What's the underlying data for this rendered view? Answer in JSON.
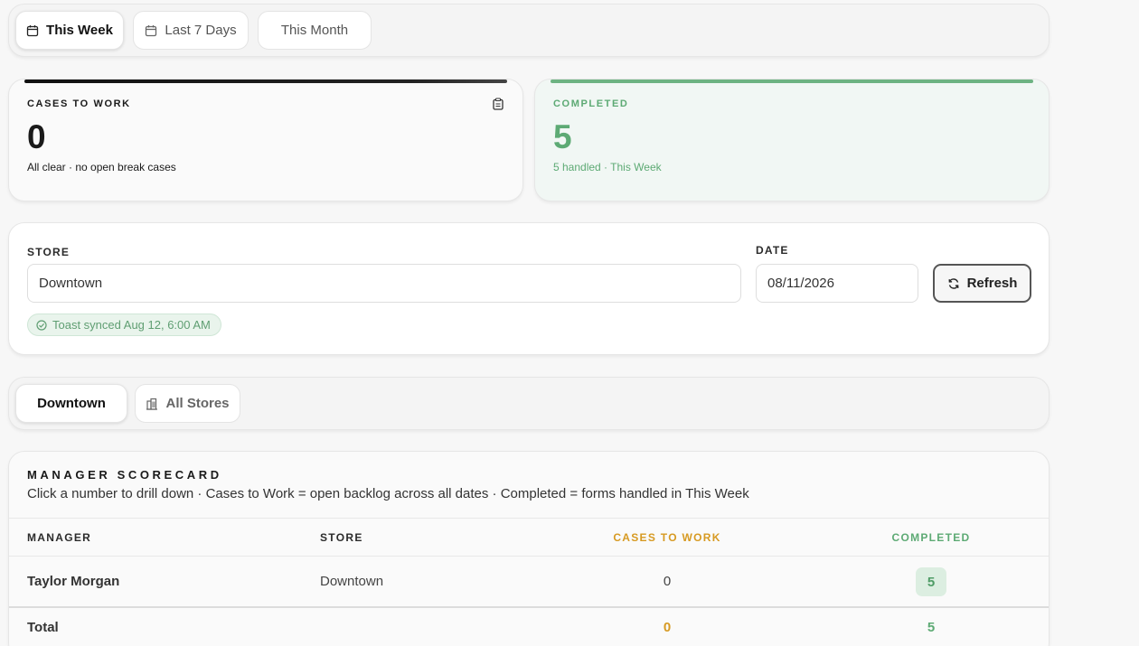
{
  "range_tabs": [
    {
      "label": "This Week",
      "icon": "calendar-icon",
      "active": true
    },
    {
      "label": "Last 7 Days",
      "icon": "calendar-icon",
      "active": false
    },
    {
      "label": "This Month",
      "icon": "",
      "active": false
    }
  ],
  "cases_card": {
    "label": "CASES TO WORK",
    "value": "0",
    "sub": "All clear · no open break cases",
    "icon": "clipboard-icon",
    "accent": "#111111"
  },
  "completed_card": {
    "label": "COMPLETED",
    "value": "5",
    "sub": "5 handled · This Week",
    "accent": "#6db382"
  },
  "filters": {
    "store_label": "STORE",
    "store_value": "Downtown",
    "date_label": "DATE",
    "date_value": "08/11/2026",
    "refresh_label": "Refresh",
    "sync_badge": "Toast synced Aug 12, 6:00 AM"
  },
  "store_tabs": [
    {
      "label": "Downtown",
      "active": true
    },
    {
      "label": "All Stores",
      "icon": "building-icon",
      "active": false
    }
  ],
  "scorecard": {
    "title": "MANAGER SCORECARD",
    "subtitle": "Click a number to drill down · Cases to Work = open backlog across all dates · Completed = forms handled in This Week",
    "columns": [
      "MANAGER",
      "STORE",
      "CASES TO WORK",
      "COMPLETED"
    ],
    "rows": [
      {
        "manager": "Taylor Morgan",
        "store": "Downtown",
        "cases": "0",
        "completed": "5"
      }
    ],
    "total": {
      "label": "Total",
      "cases": "0",
      "completed": "5"
    }
  },
  "colors": {
    "orange": "#d79a22",
    "green": "#5daa74"
  }
}
